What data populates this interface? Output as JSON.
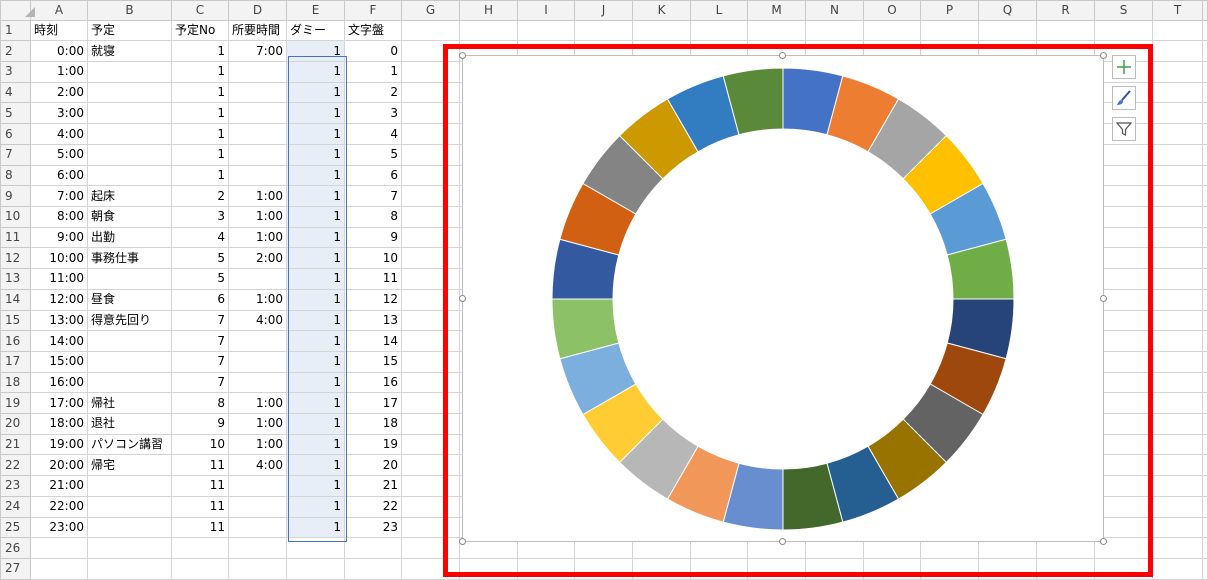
{
  "columns": [
    "A",
    "B",
    "C",
    "D",
    "E",
    "F",
    "G",
    "H",
    "I",
    "J",
    "K",
    "L",
    "M",
    "N",
    "O",
    "P",
    "Q",
    "R",
    "S",
    "T"
  ],
  "rows": [
    {
      "r": "1",
      "a": "時刻",
      "b": "予定",
      "c": "予定No",
      "d": "所要時間",
      "e": "ダミー",
      "f": "文字盤"
    },
    {
      "r": "2",
      "a": "0:00",
      "b": "就寝",
      "c": "1",
      "d": "7:00",
      "e": "1",
      "f": "0"
    },
    {
      "r": "3",
      "a": "1:00",
      "b": "",
      "c": "1",
      "d": "",
      "e": "1",
      "f": "1"
    },
    {
      "r": "4",
      "a": "2:00",
      "b": "",
      "c": "1",
      "d": "",
      "e": "1",
      "f": "2"
    },
    {
      "r": "5",
      "a": "3:00",
      "b": "",
      "c": "1",
      "d": "",
      "e": "1",
      "f": "3"
    },
    {
      "r": "6",
      "a": "4:00",
      "b": "",
      "c": "1",
      "d": "",
      "e": "1",
      "f": "4"
    },
    {
      "r": "7",
      "a": "5:00",
      "b": "",
      "c": "1",
      "d": "",
      "e": "1",
      "f": "5"
    },
    {
      "r": "8",
      "a": "6:00",
      "b": "",
      "c": "1",
      "d": "",
      "e": "1",
      "f": "6"
    },
    {
      "r": "9",
      "a": "7:00",
      "b": "起床",
      "c": "2",
      "d": "1:00",
      "e": "1",
      "f": "7"
    },
    {
      "r": "10",
      "a": "8:00",
      "b": "朝食",
      "c": "3",
      "d": "1:00",
      "e": "1",
      "f": "8"
    },
    {
      "r": "11",
      "a": "9:00",
      "b": "出勤",
      "c": "4",
      "d": "1:00",
      "e": "1",
      "f": "9"
    },
    {
      "r": "12",
      "a": "10:00",
      "b": "事務仕事",
      "c": "5",
      "d": "2:00",
      "e": "1",
      "f": "10"
    },
    {
      "r": "13",
      "a": "11:00",
      "b": "",
      "c": "5",
      "d": "",
      "e": "1",
      "f": "11"
    },
    {
      "r": "14",
      "a": "12:00",
      "b": "昼食",
      "c": "6",
      "d": "1:00",
      "e": "1",
      "f": "12"
    },
    {
      "r": "15",
      "a": "13:00",
      "b": "得意先回り",
      "c": "7",
      "d": "4:00",
      "e": "1",
      "f": "13"
    },
    {
      "r": "16",
      "a": "14:00",
      "b": "",
      "c": "7",
      "d": "",
      "e": "1",
      "f": "14"
    },
    {
      "r": "17",
      "a": "15:00",
      "b": "",
      "c": "7",
      "d": "",
      "e": "1",
      "f": "15"
    },
    {
      "r": "18",
      "a": "16:00",
      "b": "",
      "c": "7",
      "d": "",
      "e": "1",
      "f": "16"
    },
    {
      "r": "19",
      "a": "17:00",
      "b": "帰社",
      "c": "8",
      "d": "1:00",
      "e": "1",
      "f": "17"
    },
    {
      "r": "20",
      "a": "18:00",
      "b": "退社",
      "c": "9",
      "d": "1:00",
      "e": "1",
      "f": "18"
    },
    {
      "r": "21",
      "a": "19:00",
      "b": "パソコン講習",
      "c": "10",
      "d": "1:00",
      "e": "1",
      "f": "19"
    },
    {
      "r": "22",
      "a": "20:00",
      "b": "帰宅",
      "c": "11",
      "d": "4:00",
      "e": "1",
      "f": "20"
    },
    {
      "r": "23",
      "a": "21:00",
      "b": "",
      "c": "11",
      "d": "",
      "e": "1",
      "f": "21"
    },
    {
      "r": "24",
      "a": "22:00",
      "b": "",
      "c": "11",
      "d": "",
      "e": "1",
      "f": "22"
    },
    {
      "r": "25",
      "a": "23:00",
      "b": "",
      "c": "11",
      "d": "",
      "e": "1",
      "f": "23"
    },
    {
      "r": "26",
      "a": "",
      "b": "",
      "c": "",
      "d": "",
      "e": "",
      "f": ""
    },
    {
      "r": "27",
      "a": "",
      "b": "",
      "c": "",
      "d": "",
      "e": "",
      "f": ""
    }
  ],
  "chart": {
    "type": "doughnut",
    "values": [
      1,
      1,
      1,
      1,
      1,
      1,
      1,
      1,
      1,
      1,
      1,
      1,
      1,
      1,
      1,
      1,
      1,
      1,
      1,
      1,
      1,
      1,
      1,
      1
    ],
    "colors": [
      "#4472c4",
      "#ed7d31",
      "#a5a5a5",
      "#ffc000",
      "#5b9bd5",
      "#70ad47",
      "#264478",
      "#9e480e",
      "#636363",
      "#997300",
      "#255e91",
      "#43682b",
      "#698ed0",
      "#f1975a",
      "#b7b7b7",
      "#ffcd33",
      "#7cafdd",
      "#8cc168",
      "#335aa1",
      "#d26012",
      "#848484",
      "#cc9a00",
      "#327dc2",
      "#5a8a39"
    ]
  },
  "chart_buttons": [
    {
      "name": "chart-elements-button",
      "icon": "plus-icon"
    },
    {
      "name": "chart-styles-button",
      "icon": "brush-icon"
    },
    {
      "name": "chart-filters-button",
      "icon": "filter-icon"
    }
  ],
  "accent": "#ff0000",
  "selection_color": "#4472c4"
}
